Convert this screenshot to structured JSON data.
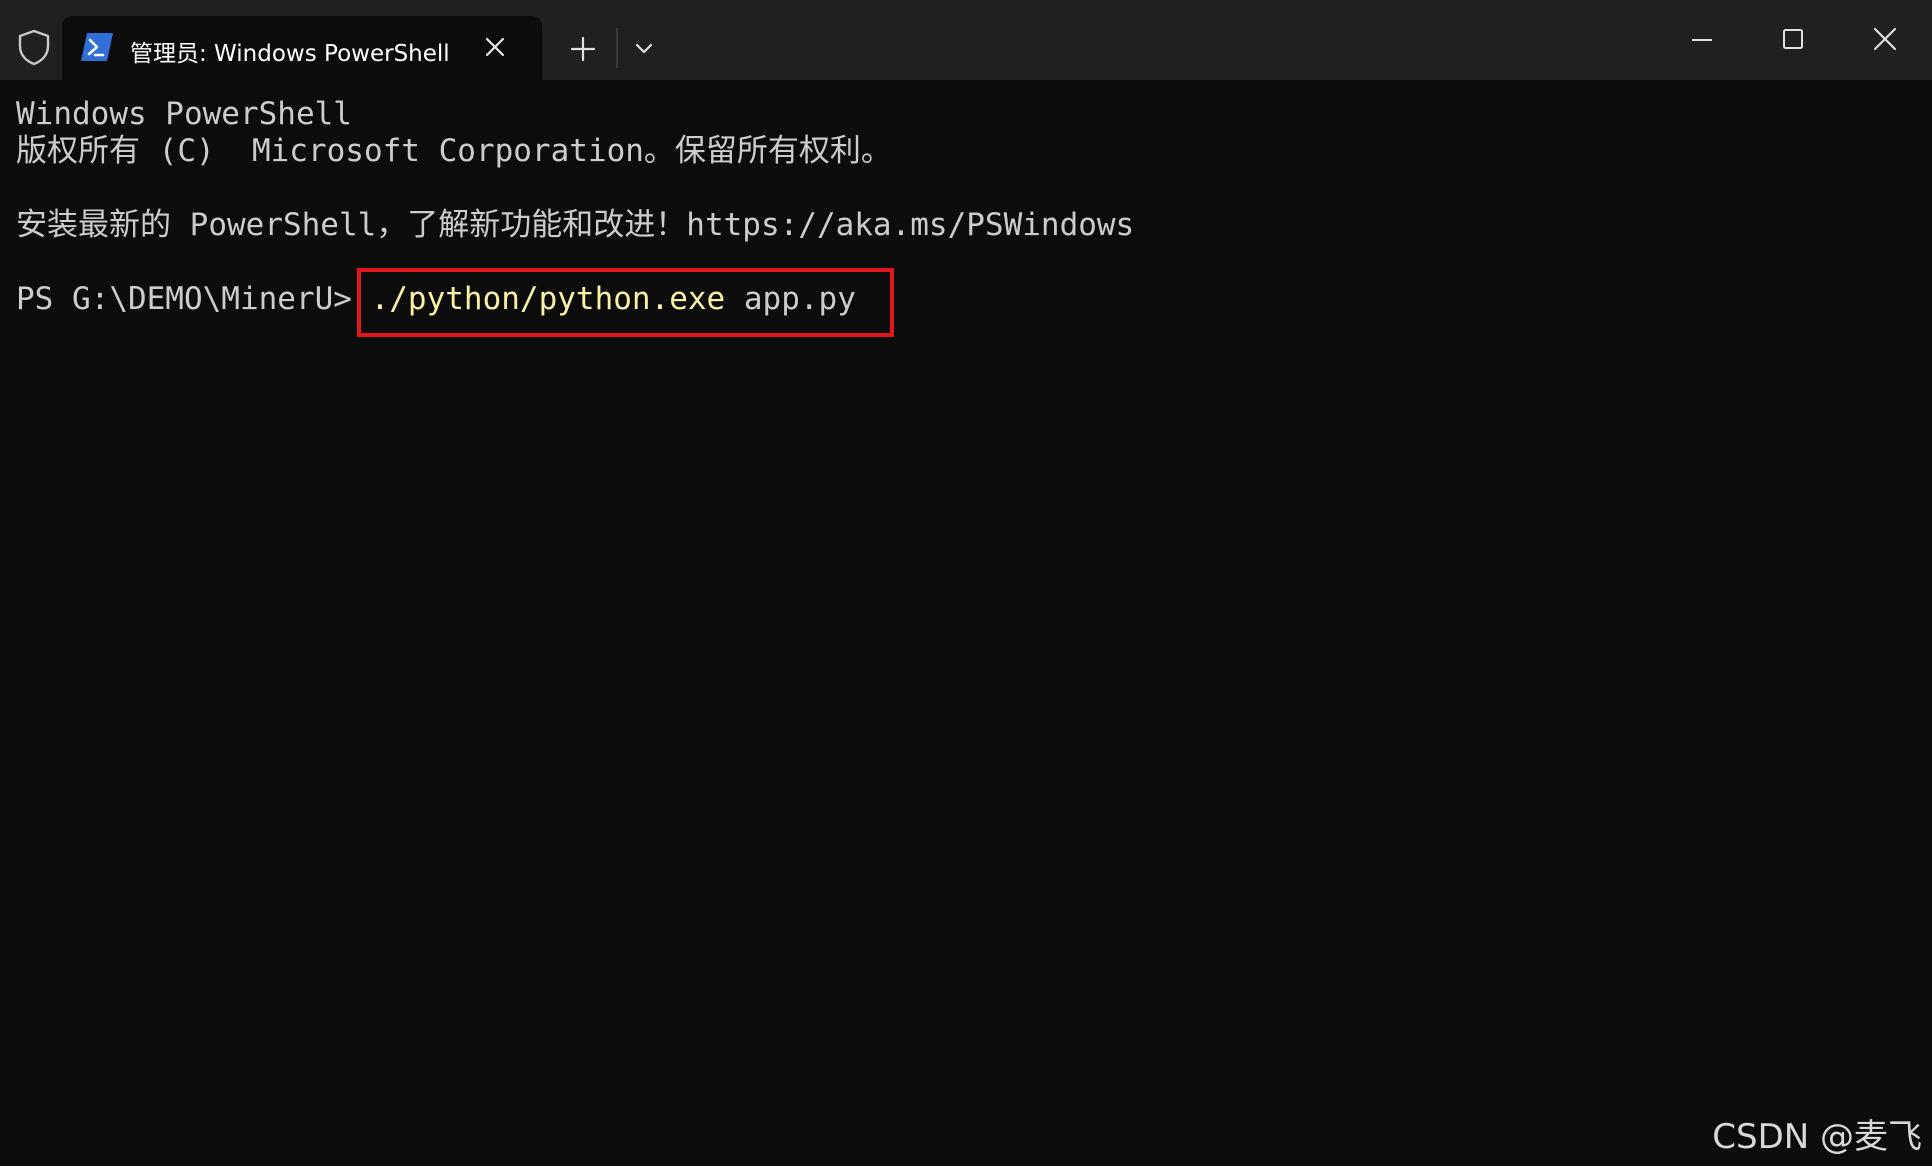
{
  "titlebar": {
    "tab_title": "管理员: Windows PowerShell",
    "icons": {
      "shield": "shield-icon",
      "powershell": "powershell-icon",
      "tab_close": "close-icon",
      "new_tab": "plus-icon",
      "dropdown": "chevron-down-icon",
      "minimize": "minimize-icon",
      "maximize": "maximize-icon",
      "close": "close-icon"
    }
  },
  "terminal": {
    "line1": "Windows PowerShell",
    "line2": "版权所有 (C)  Microsoft Corporation。保留所有权利。",
    "line4": "安装最新的 PowerShell，了解新功能和改进！https://aka.ms/PSWindows",
    "prompt": "PS G:\\DEMO\\MinerU> ",
    "command": "./python/python.exe",
    "argument": " app.py"
  },
  "watermark": "CSDN @麦飞",
  "colors": {
    "background": "#0c0c0c",
    "titlebar": "#202020",
    "text": "#cccccc",
    "command": "#f9f1a5",
    "highlight": "#e1151e",
    "ps_icon": "#2f6fd6"
  }
}
